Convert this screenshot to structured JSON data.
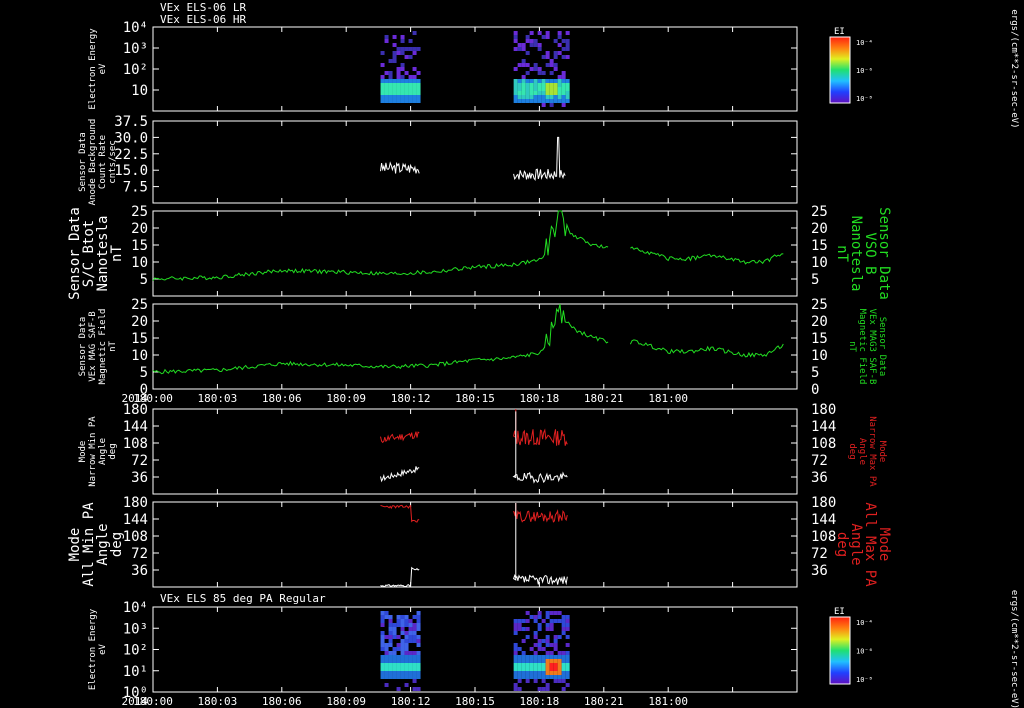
{
  "colors": {
    "white": "#ffffff",
    "green": "#22dd22",
    "red": "#e02020",
    "background": "#000000"
  },
  "header": {
    "line1": "VEx ELS-06 LR",
    "line2": "VEx ELS-06 HR",
    "panel7_title": "VEx ELS 85 deg PA Regular"
  },
  "year_label": "2014",
  "time_axis": {
    "start": "180:00",
    "end": "181:00",
    "ticks": [
      "180:00",
      "180:03",
      "180:06",
      "180:09",
      "180:12",
      "180:15",
      "180:18",
      "180:21",
      "181:00"
    ]
  },
  "colorbar_units": "ergs/(cm**2-sr-sec-eV)",
  "chart_data": [
    {
      "id": "p1",
      "type": "heatmap",
      "ylabel": [
        "Electron Energy",
        "eV"
      ],
      "yscale": "log",
      "ylim": [
        1,
        10000
      ],
      "yticks": [
        "10",
        "10²",
        "10³",
        "10⁴"
      ],
      "colorbar": {
        "title": "EI",
        "ticks": [
          "10⁻⁴",
          "10⁻⁶",
          "10⁻⁸"
        ]
      },
      "data_intervals": [
        [
          "180:10.6",
          "180:12.4"
        ],
        [
          "180:16.8",
          "180:19.3"
        ]
      ]
    },
    {
      "id": "p2",
      "type": "line",
      "ylabel": [
        "Sensor Data",
        "Anode Background",
        "Count Rate",
        "cnts/sec"
      ],
      "ylim": [
        0,
        37.5
      ],
      "yticks": [
        "7.5",
        "15.0",
        "22.5",
        "30.0",
        "37.5"
      ],
      "series": [
        {
          "color": "#ffffff",
          "segments": [
            {
              "x0": 10.6,
              "x1": 12.4,
              "base": 16,
              "amp": 2.6,
              "seed": 3
            },
            {
              "x0": 16.8,
              "x1": 19.2,
              "base": 13,
              "amp": 2.6,
              "seed": 7,
              "spike": {
                "x": 18.85,
                "y": 30
              }
            }
          ]
        }
      ]
    },
    {
      "id": "p3",
      "type": "line",
      "ylabel": [
        "Sensor Data",
        "S/C Btot",
        "Nanotesla",
        "nT"
      ],
      "ylabel_right": [
        "Sensor Data",
        "VSO B",
        "Nanotesla",
        "nT"
      ],
      "ylim": [
        0,
        25
      ],
      "yticks": [
        "5",
        "10",
        "15",
        "20",
        "25"
      ],
      "series": [
        {
          "color": "#22dd22",
          "points": [
            [
              0,
              5
            ],
            [
              3,
              5.5
            ],
            [
              6,
              7.5
            ],
            [
              9,
              7
            ],
            [
              11,
              6.5
            ],
            [
              13,
              7
            ],
            [
              15,
              8.5
            ],
            [
              16.5,
              9
            ],
            [
              17.5,
              10
            ],
            [
              18.2,
              11
            ],
            [
              18.6,
              19
            ],
            [
              18.9,
              24
            ],
            [
              19.2,
              21
            ],
            [
              19.5,
              18
            ],
            [
              20.5,
              15
            ],
            [
              21.2,
              14
            ],
            [
              21.5,
              13
            ],
            [
              22.5,
              14
            ],
            [
              23.5,
              12
            ],
            [
              24,
              11
            ],
            [
              25,
              11
            ],
            [
              26,
              12
            ],
            [
              27.5,
              10
            ],
            [
              28.5,
              10
            ],
            [
              29.4,
              13
            ]
          ],
          "gaps": [
            [
              21.2,
              22.2
            ]
          ]
        }
      ]
    },
    {
      "id": "p4",
      "type": "line",
      "ylabel": [
        "Sensor Data",
        "VEx MAG SAF-B",
        "Magnetic Field",
        "nT"
      ],
      "ylabel_right": [
        "Sensor Data",
        "VEx MAG3 SAF-B",
        "Magnetic Field",
        "nT"
      ],
      "ylim": [
        0,
        25
      ],
      "yticks": [
        "0",
        "5",
        "10",
        "15",
        "20",
        "25"
      ],
      "series": [
        {
          "color": "#22dd22",
          "points": [
            [
              0,
              5
            ],
            [
              3,
              5.5
            ],
            [
              6,
              7.5
            ],
            [
              9,
              7
            ],
            [
              11,
              6.5
            ],
            [
              13,
              7
            ],
            [
              15,
              8.5
            ],
            [
              16.5,
              9
            ],
            [
              17.5,
              10
            ],
            [
              18.2,
              11
            ],
            [
              18.6,
              19
            ],
            [
              18.9,
              24
            ],
            [
              19.2,
              21
            ],
            [
              19.5,
              18
            ],
            [
              20.5,
              15
            ],
            [
              21.2,
              14
            ],
            [
              21.5,
              13
            ],
            [
              22.5,
              14
            ],
            [
              23.5,
              12
            ],
            [
              24,
              11
            ],
            [
              25,
              11
            ],
            [
              26,
              12
            ],
            [
              27.5,
              10
            ],
            [
              28.5,
              10
            ],
            [
              29.4,
              13
            ]
          ],
          "gaps": [
            [
              21.2,
              22.2
            ]
          ]
        }
      ]
    },
    {
      "id": "p5",
      "type": "line",
      "ylabel": [
        "Mode",
        "Narrow Min PA",
        "Angle",
        "deg"
      ],
      "ylabel_right": [
        "Mode",
        "Narrow Max PA",
        "Angle",
        "deg"
      ],
      "ylim": [
        0,
        180
      ],
      "yticks": [
        "36",
        "72",
        "108",
        "144",
        "180"
      ],
      "series": [
        {
          "color": "#e02020",
          "segments": [
            {
              "x0": 10.6,
              "x1": 12.4,
              "base": 115,
              "amp": 8,
              "seed": 11,
              "end": 130
            },
            {
              "x0": 16.8,
              "x1": 19.3,
              "base": 120,
              "amp": 18,
              "seed": 13,
              "spike": {
                "x": 16.9,
                "y": 180
              }
            }
          ]
        },
        {
          "color": "#ffffff",
          "segments": [
            {
              "x0": 10.6,
              "x1": 12.4,
              "base": 32,
              "amp": 6,
              "seed": 17,
              "end": 60
            },
            {
              "x0": 16.8,
              "x1": 19.3,
              "base": 35,
              "amp": 10,
              "seed": 19,
              "spike": {
                "x": 16.9,
                "y": 175
              }
            }
          ]
        }
      ]
    },
    {
      "id": "p6",
      "type": "line",
      "ylabel": [
        "Mode",
        "All Min PA",
        "Angle",
        "deg"
      ],
      "ylabel_right": [
        "Mode",
        "All Max PA",
        "Angle",
        "deg"
      ],
      "ylim": [
        0,
        180
      ],
      "yticks": [
        "36",
        "72",
        "108",
        "144",
        "180"
      ],
      "series": [
        {
          "color": "#e02020",
          "segments": [
            {
              "x0": 10.6,
              "x1": 12.4,
              "base": 170,
              "amp": 3,
              "seed": 23,
              "drop": {
                "x": 12.0,
                "y": 140
              }
            },
            {
              "x0": 16.8,
              "x1": 19.3,
              "base": 150,
              "amp": 12,
              "seed": 29,
              "spike": {
                "x": 16.9,
                "y": 178
              }
            }
          ]
        },
        {
          "color": "#ffffff",
          "segments": [
            {
              "x0": 10.6,
              "x1": 12.4,
              "base": 3,
              "amp": 2,
              "seed": 31,
              "rise": {
                "x": 12.0,
                "y": 40
              }
            },
            {
              "x0": 16.8,
              "x1": 19.3,
              "base": 15,
              "amp": 10,
              "seed": 37,
              "spike": {
                "x": 16.9,
                "y": 178
              }
            }
          ]
        }
      ]
    },
    {
      "id": "p7",
      "type": "heatmap",
      "ylabel": [
        "Electron Energy",
        "eV"
      ],
      "yscale": "log",
      "ylim": [
        1,
        10000
      ],
      "yticks": [
        "10⁰",
        "10¹",
        "10²",
        "10³",
        "10⁴"
      ],
      "colorbar": {
        "title": "EI",
        "ticks": [
          "10⁻⁴",
          "10⁻⁶",
          "10⁻⁸"
        ]
      },
      "data_intervals": [
        [
          "180:10.6",
          "180:12.4"
        ],
        [
          "180:16.8",
          "180:19.3"
        ]
      ]
    }
  ]
}
